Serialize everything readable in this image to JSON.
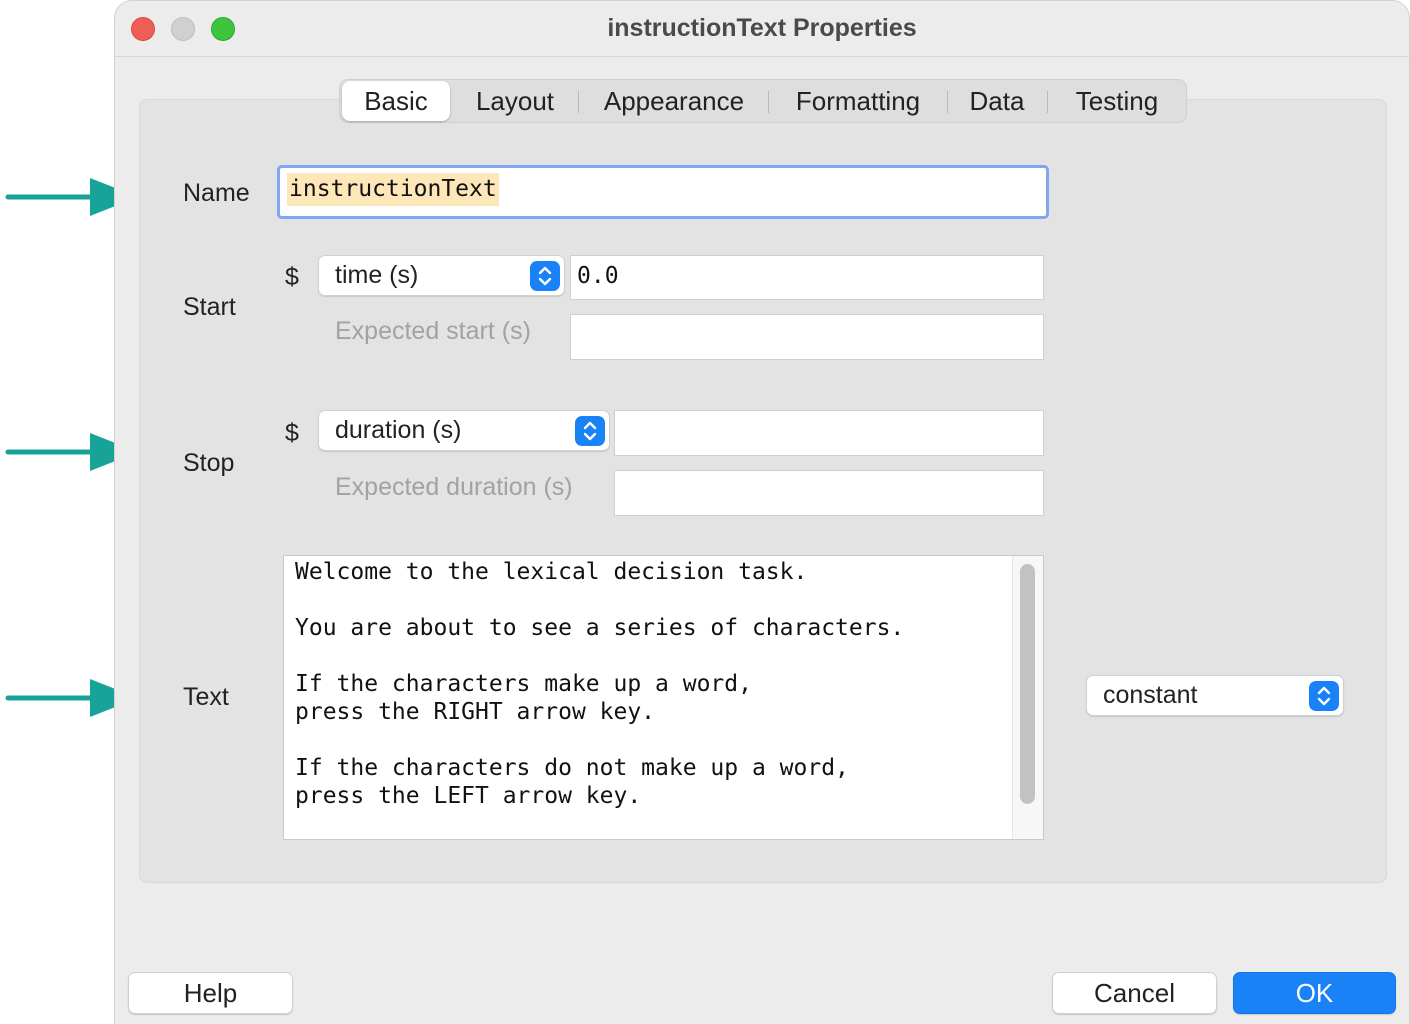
{
  "window": {
    "title": "instructionText Properties"
  },
  "tabs": [
    {
      "label": "Basic",
      "active": true
    },
    {
      "label": "Layout",
      "active": false
    },
    {
      "label": "Appearance",
      "active": false
    },
    {
      "label": "Formatting",
      "active": false
    },
    {
      "label": "Data",
      "active": false
    },
    {
      "label": "Testing",
      "active": false
    }
  ],
  "name": {
    "label": "Name",
    "value": "instructionText"
  },
  "start": {
    "label": "Start",
    "dollar": "$",
    "type_selected": "time (s)",
    "value": "0.0",
    "expected_label": "Expected start (s)",
    "expected_value": ""
  },
  "stop": {
    "label": "Stop",
    "dollar": "$",
    "type_selected": "duration (s)",
    "value": "",
    "expected_label": "Expected duration (s)",
    "expected_value": ""
  },
  "text": {
    "label": "Text",
    "value": "Welcome to the lexical decision task.\n\nYou are about to see a series of characters.\n\nIf the characters make up a word,\npress the RIGHT arrow key.\n\nIf the characters do not make up a word,\npress the LEFT arrow key.",
    "update_selected": "constant"
  },
  "buttons": {
    "help": "Help",
    "cancel": "Cancel",
    "ok": "OK"
  },
  "colors": {
    "accent": "#1a82f7",
    "annotation_arrow": "#17a398",
    "name_highlight": "#fde7b8"
  },
  "icons": {
    "stepper": "up-down-chevron-icon",
    "annotation": "right-arrow-icon"
  }
}
